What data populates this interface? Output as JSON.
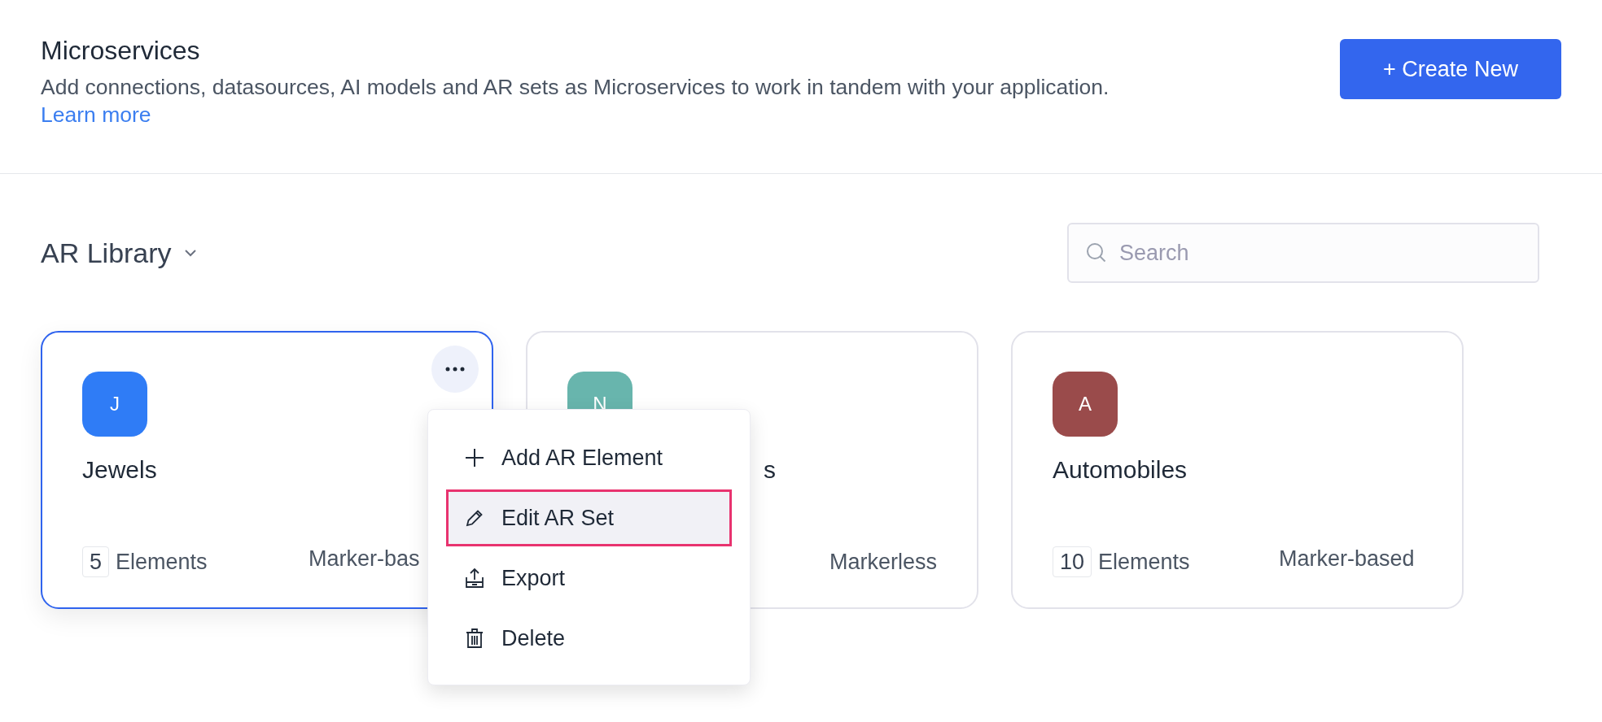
{
  "header": {
    "title": "Microservices",
    "description": "Add connections, datasources, AI models and AR sets as Microservices to work in tandem with your application.",
    "link": "Learn more",
    "button": "+ Create New"
  },
  "library": {
    "title": "AR Library",
    "search": {
      "placeholder": "Search"
    }
  },
  "cards": [
    {
      "initial": "J",
      "color": "#2f7cf6",
      "name": "Jewels",
      "count": "5",
      "count_label": "Elements",
      "type": "Marker-bas",
      "selected": true
    },
    {
      "initial": "N",
      "color": "#68b5ad",
      "name": "s",
      "type": "Markerless",
      "selected": false,
      "covered": true
    },
    {
      "initial": "A",
      "color": "#9a4b4b",
      "name": "Automobiles",
      "count": "10",
      "count_label": "Elements",
      "type": "Marker-based",
      "selected": false
    }
  ],
  "menu": [
    {
      "kind": "add",
      "label": "Add AR Element",
      "selected": false
    },
    {
      "kind": "edit",
      "label": "Edit AR Set",
      "selected": true
    },
    {
      "kind": "export",
      "label": "Export",
      "selected": false
    },
    {
      "kind": "delete",
      "label": "Delete",
      "selected": false
    }
  ]
}
